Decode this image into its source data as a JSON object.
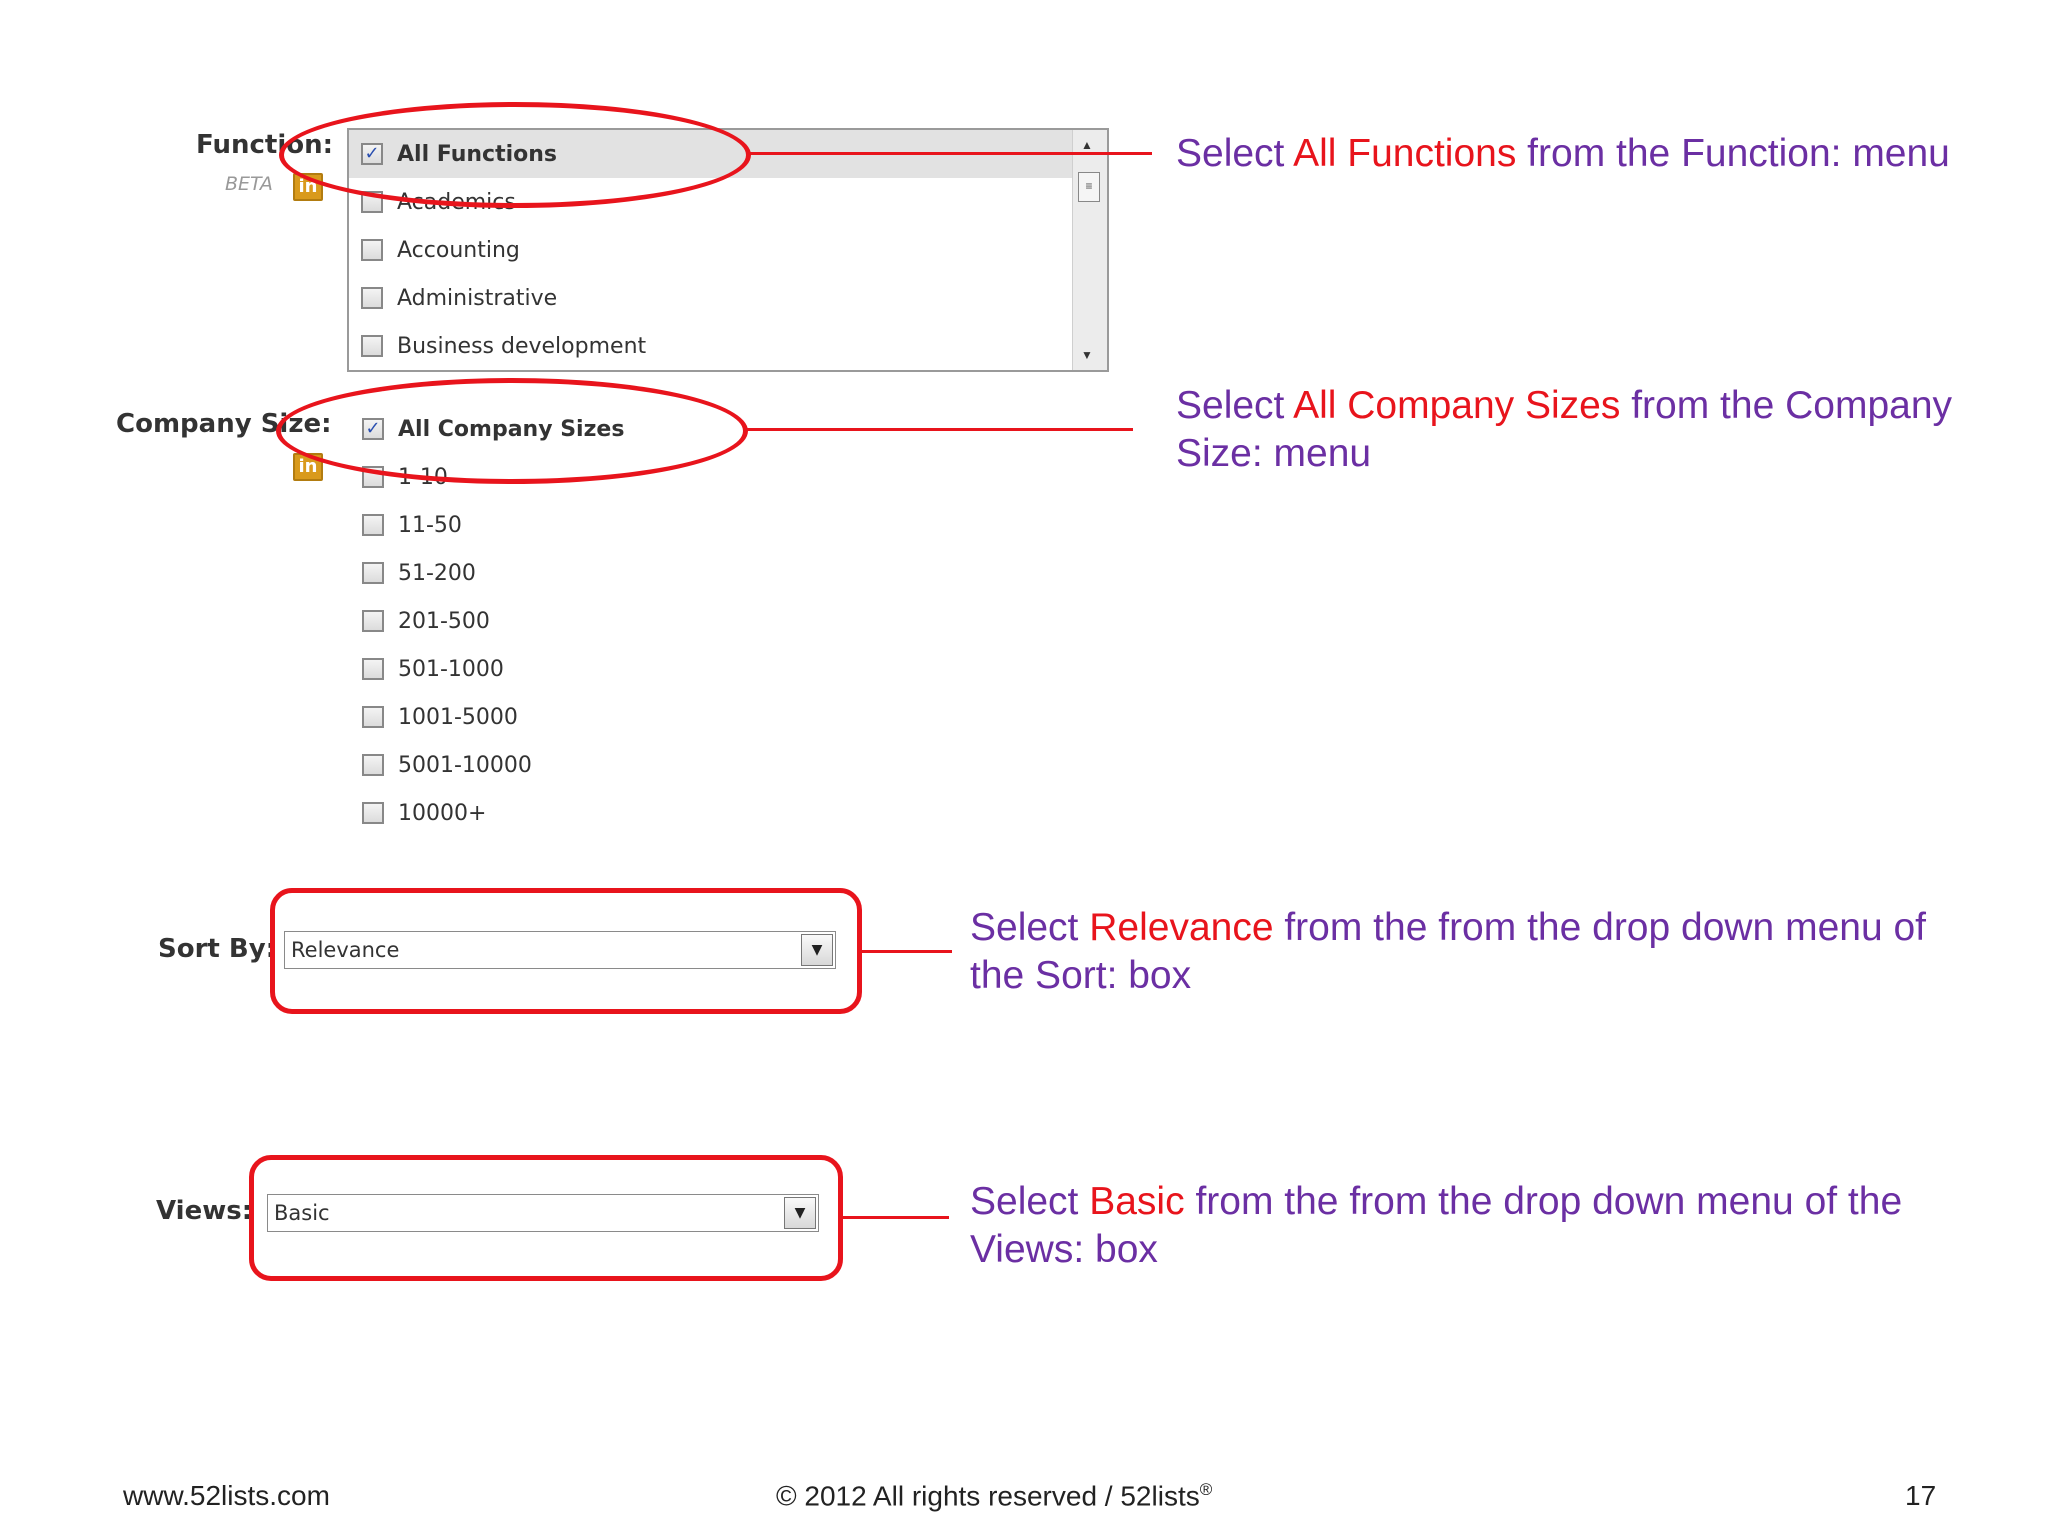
{
  "function_filter": {
    "label": "Function:",
    "beta": "BETA",
    "icon_text": "in",
    "options": [
      {
        "label": "All Functions",
        "checked": true
      },
      {
        "label": "Academics",
        "checked": false
      },
      {
        "label": "Accounting",
        "checked": false
      },
      {
        "label": "Administrative",
        "checked": false
      },
      {
        "label": "Business development",
        "checked": false
      }
    ]
  },
  "company_size_filter": {
    "label": "Company Size:",
    "icon_text": "in",
    "options": [
      {
        "label": "All Company Sizes",
        "checked": true
      },
      {
        "label": "1-10",
        "checked": false
      },
      {
        "label": "11-50",
        "checked": false
      },
      {
        "label": "51-200",
        "checked": false
      },
      {
        "label": "201-500",
        "checked": false
      },
      {
        "label": "501-1000",
        "checked": false
      },
      {
        "label": "1001-5000",
        "checked": false
      },
      {
        "label": "5001-10000",
        "checked": false
      },
      {
        "label": "10000+",
        "checked": false
      }
    ]
  },
  "sort_by": {
    "label": "Sort By:",
    "value": "Relevance"
  },
  "views": {
    "label": "Views:",
    "value": "Basic"
  },
  "annotations": {
    "function": {
      "pre": "Select ",
      "highlight": "All Functions",
      "post": " from the Function: menu"
    },
    "company_size": {
      "pre": "Select ",
      "highlight": "All Company Sizes",
      "post": " from the Company Size: menu"
    },
    "sort": {
      "pre": "Select ",
      "highlight": "Relevance",
      "post": " from the from the drop down menu of the Sort: box"
    },
    "views": {
      "pre": "Select ",
      "highlight": "Basic",
      "post": " from the from the drop down menu of the Views: box"
    }
  },
  "footer": {
    "website": "www.52lists.com",
    "copyright": "© 2012 All rights reserved / 52lists",
    "registered": "®",
    "page_number": "17"
  },
  "colors": {
    "highlight": "#e8141c",
    "annotation_text": "#6b2fa3"
  }
}
